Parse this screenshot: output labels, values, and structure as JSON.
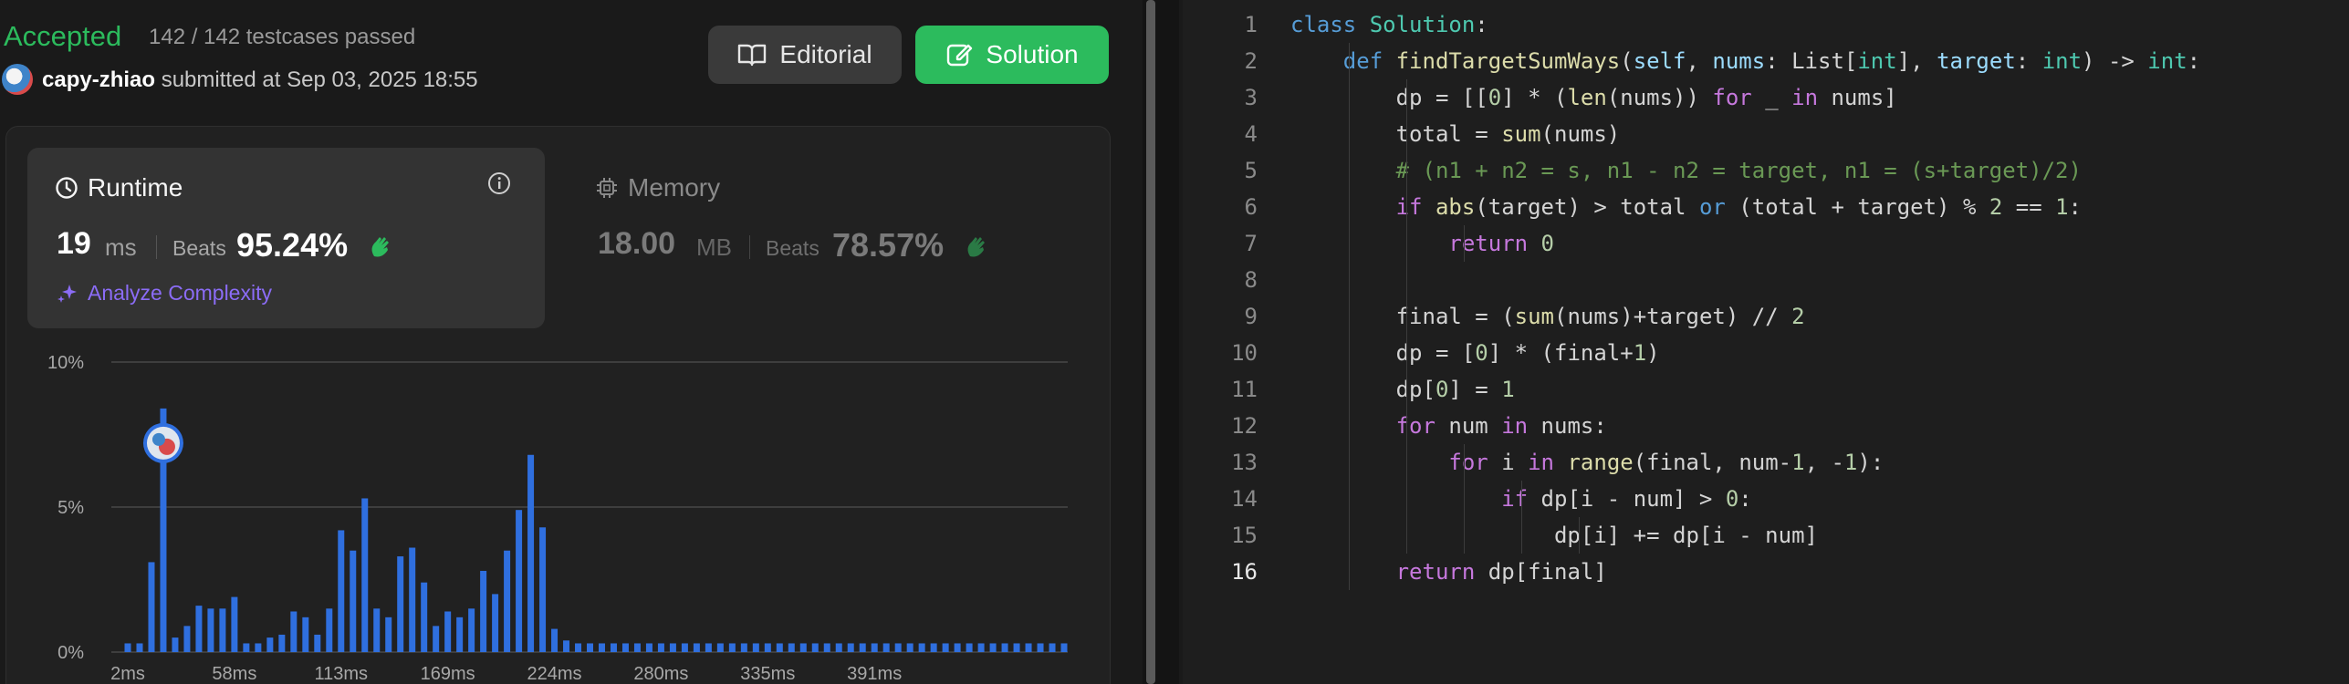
{
  "submission": {
    "status": "Accepted",
    "testcases": "142 / 142 testcases passed",
    "user": "capy-zhiao",
    "submitted_text": "submitted at Sep 03, 2025 18:55"
  },
  "buttons": {
    "editorial": "Editorial",
    "solution": "Solution"
  },
  "runtime": {
    "title": "Runtime",
    "value": "19",
    "unit": "ms",
    "beats_label": "Beats",
    "beats_value": "95.24%",
    "analyze": "Analyze Complexity"
  },
  "memory": {
    "title": "Memory",
    "value": "18.00",
    "unit": "MB",
    "beats_label": "Beats",
    "beats_value": "78.57%"
  },
  "colors": {
    "accent_green": "#2cbb5d",
    "bar_blue": "#2f6fdf",
    "analyze_purple": "#8b6cf6"
  },
  "chart_data": {
    "type": "bar",
    "y_ticks": [
      "10%",
      "5%",
      "0%"
    ],
    "x_tick_labels": [
      "2ms",
      "58ms",
      "113ms",
      "169ms",
      "224ms",
      "280ms",
      "335ms",
      "391ms"
    ],
    "ylim": [
      0,
      10
    ],
    "highlight_index": 3,
    "values": [
      0.3,
      0.3,
      3.1,
      8.4,
      0.5,
      0.9,
      1.6,
      1.5,
      1.5,
      1.9,
      0.3,
      0.3,
      0.5,
      0.6,
      1.4,
      1.2,
      0.6,
      1.5,
      4.2,
      3.5,
      5.3,
      1.5,
      1.2,
      3.3,
      3.6,
      2.4,
      0.9,
      1.4,
      1.2,
      1.5,
      2.8,
      2.0,
      3.5,
      4.9,
      6.8,
      4.3,
      0.8,
      0.4,
      0.3,
      0.3,
      0.3,
      0.3,
      0.3,
      0.3,
      0.3,
      0.3,
      0.3,
      0.3,
      0.3,
      0.3,
      0.3,
      0.3,
      0.3,
      0.3,
      0.3,
      0.3,
      0.3,
      0.3,
      0.3,
      0.3,
      0.3,
      0.3,
      0.3,
      0.3,
      0.3,
      0.3,
      0.3,
      0.3,
      0.3,
      0.3,
      0.3,
      0.3,
      0.3,
      0.3,
      0.3,
      0.3,
      0.3,
      0.3,
      0.3,
      0.3
    ]
  },
  "code": {
    "active_line": 16,
    "lines": [
      [
        [
          "kw2",
          "class"
        ],
        [
          "",
          " "
        ],
        [
          "ty",
          "Solution"
        ],
        [
          "",
          ":"
        ]
      ],
      [
        [
          "",
          "    "
        ],
        [
          "kw2",
          "def"
        ],
        [
          "",
          " "
        ],
        [
          "fn",
          "findTargetSumWays"
        ],
        [
          "",
          "("
        ],
        [
          "pm",
          "self"
        ],
        [
          "",
          ", "
        ],
        [
          "pm",
          "nums"
        ],
        [
          "",
          ": List["
        ],
        [
          "ty",
          "int"
        ],
        [
          "",
          "], "
        ],
        [
          "pm",
          "target"
        ],
        [
          "",
          ": "
        ],
        [
          "ty",
          "int"
        ],
        [
          "",
          ") -> "
        ],
        [
          "ty",
          "int"
        ],
        [
          "",
          ":"
        ]
      ],
      [
        [
          "",
          "        dp = [["
        ],
        [
          "num",
          "0"
        ],
        [
          "",
          "] * ("
        ],
        [
          "fn",
          "len"
        ],
        [
          "",
          "(nums)) "
        ],
        [
          "kw",
          "for"
        ],
        [
          "",
          " _ "
        ],
        [
          "kw",
          "in"
        ],
        [
          "",
          " nums]"
        ]
      ],
      [
        [
          "",
          "        total = "
        ],
        [
          "fn",
          "sum"
        ],
        [
          "",
          "(nums)"
        ]
      ],
      [
        [
          "",
          "        "
        ],
        [
          "cm",
          "# (n1 + n2 = s, n1 - n2 = target, n1 = (s+target)/2)"
        ]
      ],
      [
        [
          "",
          "        "
        ],
        [
          "kw",
          "if"
        ],
        [
          "",
          " "
        ],
        [
          "fn",
          "abs"
        ],
        [
          "",
          "(target) > total "
        ],
        [
          "kw2",
          "or"
        ],
        [
          "",
          " (total + target) % "
        ],
        [
          "num",
          "2"
        ],
        [
          "",
          " == "
        ],
        [
          "num",
          "1"
        ],
        [
          "",
          ":"
        ]
      ],
      [
        [
          "",
          "            "
        ],
        [
          "kw",
          "return"
        ],
        [
          "",
          " "
        ],
        [
          "num",
          "0"
        ]
      ],
      [
        [
          "",
          ""
        ]
      ],
      [
        [
          "",
          "        final = ("
        ],
        [
          "fn",
          "sum"
        ],
        [
          "",
          "(nums)+target) // "
        ],
        [
          "num",
          "2"
        ]
      ],
      [
        [
          "",
          "        dp = ["
        ],
        [
          "num",
          "0"
        ],
        [
          "",
          "] * (final+"
        ],
        [
          "num",
          "1"
        ],
        [
          "",
          ")"
        ]
      ],
      [
        [
          "",
          "        dp["
        ],
        [
          "num",
          "0"
        ],
        [
          "",
          "] = "
        ],
        [
          "num",
          "1"
        ]
      ],
      [
        [
          "",
          "        "
        ],
        [
          "kw",
          "for"
        ],
        [
          "",
          " num "
        ],
        [
          "kw",
          "in"
        ],
        [
          "",
          " nums:"
        ]
      ],
      [
        [
          "",
          "            "
        ],
        [
          "kw",
          "for"
        ],
        [
          "",
          " i "
        ],
        [
          "kw",
          "in"
        ],
        [
          "",
          " "
        ],
        [
          "fn",
          "range"
        ],
        [
          "",
          "(final, num-"
        ],
        [
          "num",
          "1"
        ],
        [
          "",
          ", -"
        ],
        [
          "num",
          "1"
        ],
        [
          "",
          "):"
        ]
      ],
      [
        [
          "",
          "                "
        ],
        [
          "kw",
          "if"
        ],
        [
          "",
          " dp[i - num] > "
        ],
        [
          "num",
          "0"
        ],
        [
          "",
          ":"
        ]
      ],
      [
        [
          "",
          "                    dp[i] += dp[i - num]"
        ]
      ],
      [
        [
          "",
          "        "
        ],
        [
          "kw",
          "return"
        ],
        [
          "",
          " dp[final]"
        ]
      ]
    ]
  }
}
